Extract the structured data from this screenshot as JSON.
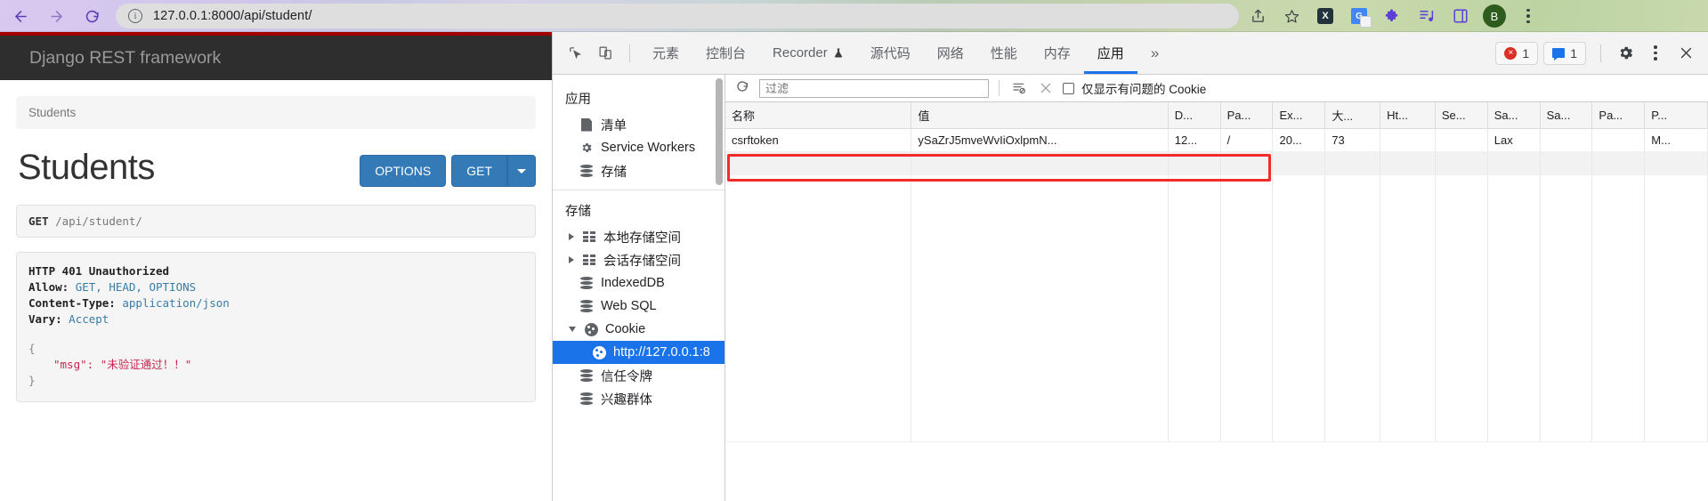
{
  "browser": {
    "back_icon": "back-arrow-icon",
    "forward_icon": "forward-arrow-icon",
    "reload_icon": "reload-icon",
    "info_icon": "page-info-icon",
    "url": "127.0.0.1:8000/api/student/",
    "url_host": "127.0.0.1:8000",
    "url_path": "/api/student/",
    "toolbar_icons": [
      "share-icon",
      "bookmark-star-icon",
      "x-extension-icon",
      "google-translate-icon",
      "extensions-puzzle-icon",
      "reading-list-icon",
      "side-panel-icon"
    ],
    "profile_initial": "B",
    "menu_icon": "kebab-menu-icon"
  },
  "drf": {
    "brand": "Django REST framework",
    "breadcrumb": "Students",
    "title": "Students",
    "options_label": "OPTIONS",
    "get_label": "GET",
    "request_method": "GET",
    "request_path": "/api/student/",
    "response": {
      "status": "HTTP 401 Unauthorized",
      "headers": [
        {
          "key": "Allow:",
          "value": "GET, HEAD, OPTIONS"
        },
        {
          "key": "Content-Type:",
          "value": "application/json"
        },
        {
          "key": "Vary:",
          "value": "Accept"
        }
      ],
      "body_open": "{",
      "body_key": "\"msg\":",
      "body_value": "\"未验证通过！！\"",
      "body_close": "}"
    }
  },
  "devtools": {
    "inspect_icon": "inspect-element-icon",
    "device_icon": "device-toolbar-icon",
    "tabs": [
      {
        "label": "元素",
        "active": false
      },
      {
        "label": "控制台",
        "active": false
      },
      {
        "label": "Recorder",
        "active": false,
        "icon": "flask-icon"
      },
      {
        "label": "源代码",
        "active": false
      },
      {
        "label": "网络",
        "active": false
      },
      {
        "label": "性能",
        "active": false
      },
      {
        "label": "内存",
        "active": false
      },
      {
        "label": "应用",
        "active": true
      }
    ],
    "more_tabs_icon": "chevron-double-right-icon",
    "error_count": "1",
    "warning_count": "1",
    "settings_icon": "gear-icon",
    "dt_menu_icon": "kebab-menu-icon",
    "close_icon": "close-icon",
    "sidebar": {
      "application_section": "应用",
      "application_items": [
        {
          "label": "清单",
          "icon": "manifest-document-icon"
        },
        {
          "label": "Service Workers",
          "icon": "gear-icon"
        },
        {
          "label": "存储",
          "icon": "database-icon"
        }
      ],
      "storage_section": "存储",
      "storage_items": [
        {
          "label": "本地存储空间",
          "icon": "table-icon",
          "expandable": true,
          "expanded": false
        },
        {
          "label": "会话存储空间",
          "icon": "table-icon",
          "expandable": true,
          "expanded": false
        },
        {
          "label": "IndexedDB",
          "icon": "database-icon",
          "expandable": false
        },
        {
          "label": "Web SQL",
          "icon": "database-icon",
          "expandable": false
        },
        {
          "label": "Cookie",
          "icon": "cookie-icon",
          "expandable": true,
          "expanded": true
        },
        {
          "label": "http://127.0.0.1:8",
          "icon": "cookie-icon",
          "selected": true,
          "child": true
        },
        {
          "label": "信任令牌",
          "icon": "database-icon",
          "expandable": false
        },
        {
          "label": "兴趣群体",
          "icon": "database-icon",
          "expandable": false
        }
      ]
    },
    "cookies": {
      "refresh_icon": "refresh-icon",
      "filter_placeholder": "过滤",
      "clear_filtered_icon": "clear-filtered-cookies-icon",
      "clear_all_icon": "clear-all-cookies-icon",
      "problem_only_label": "仅显示有问题的 Cookie",
      "problem_only_checked": false,
      "columns": [
        "名称",
        "值",
        "D...",
        "Pa...",
        "Ex...",
        "大...",
        "Ht...",
        "Se...",
        "Sa...",
        "Sa...",
        "Pa...",
        "P..."
      ],
      "rows": [
        {
          "name": "csrftoken",
          "value": "ySaZrJ5mveWvIiOxlpmN...",
          "domain": "12...",
          "path": "/",
          "expires": "20...",
          "size": "73",
          "httponly": "",
          "secure": "",
          "samesite": "Lax",
          "samesite2": "",
          "partition": "",
          "priority": "M..."
        }
      ],
      "highlighted_empty_row": true,
      "highlight_color": "#f42b2b"
    }
  }
}
